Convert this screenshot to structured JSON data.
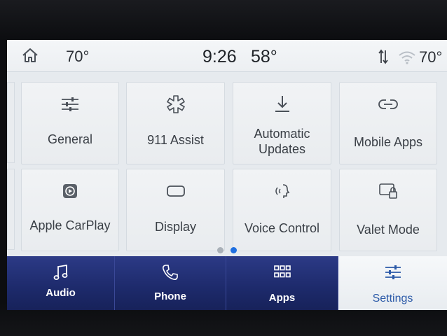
{
  "status_bar": {
    "left_temp": "70°",
    "time": "9:26",
    "outside_temp": "58°",
    "right_temp": "70°"
  },
  "tiles": [
    {
      "label": "General",
      "icon": "sliders-icon"
    },
    {
      "label": "911 Assist",
      "icon": "emergency-star-icon"
    },
    {
      "label": "Automatic\nUpdates",
      "icon": "download-icon"
    },
    {
      "label": "Mobile Apps",
      "icon": "link-icon"
    },
    {
      "label": "Apple CarPlay",
      "icon": "carplay-icon"
    },
    {
      "label": "Display",
      "icon": "display-icon"
    },
    {
      "label": "Voice Control",
      "icon": "voice-icon"
    },
    {
      "label": "Valet Mode",
      "icon": "valet-lock-icon"
    }
  ],
  "pagination": {
    "count": 2,
    "active_index": 1
  },
  "nav": [
    {
      "label": "Audio",
      "icon": "music-note-icon"
    },
    {
      "label": "Phone",
      "icon": "phone-icon"
    },
    {
      "label": "Apps",
      "icon": "apps-grid-icon"
    },
    {
      "label": "Settings",
      "icon": "sliders-icon"
    }
  ],
  "colors": {
    "nav_bg": "#1d2a6b",
    "active_accent": "#2c5aa8",
    "dot_active": "#1f6fe0",
    "dot_inactive": "#a9b0b8"
  }
}
